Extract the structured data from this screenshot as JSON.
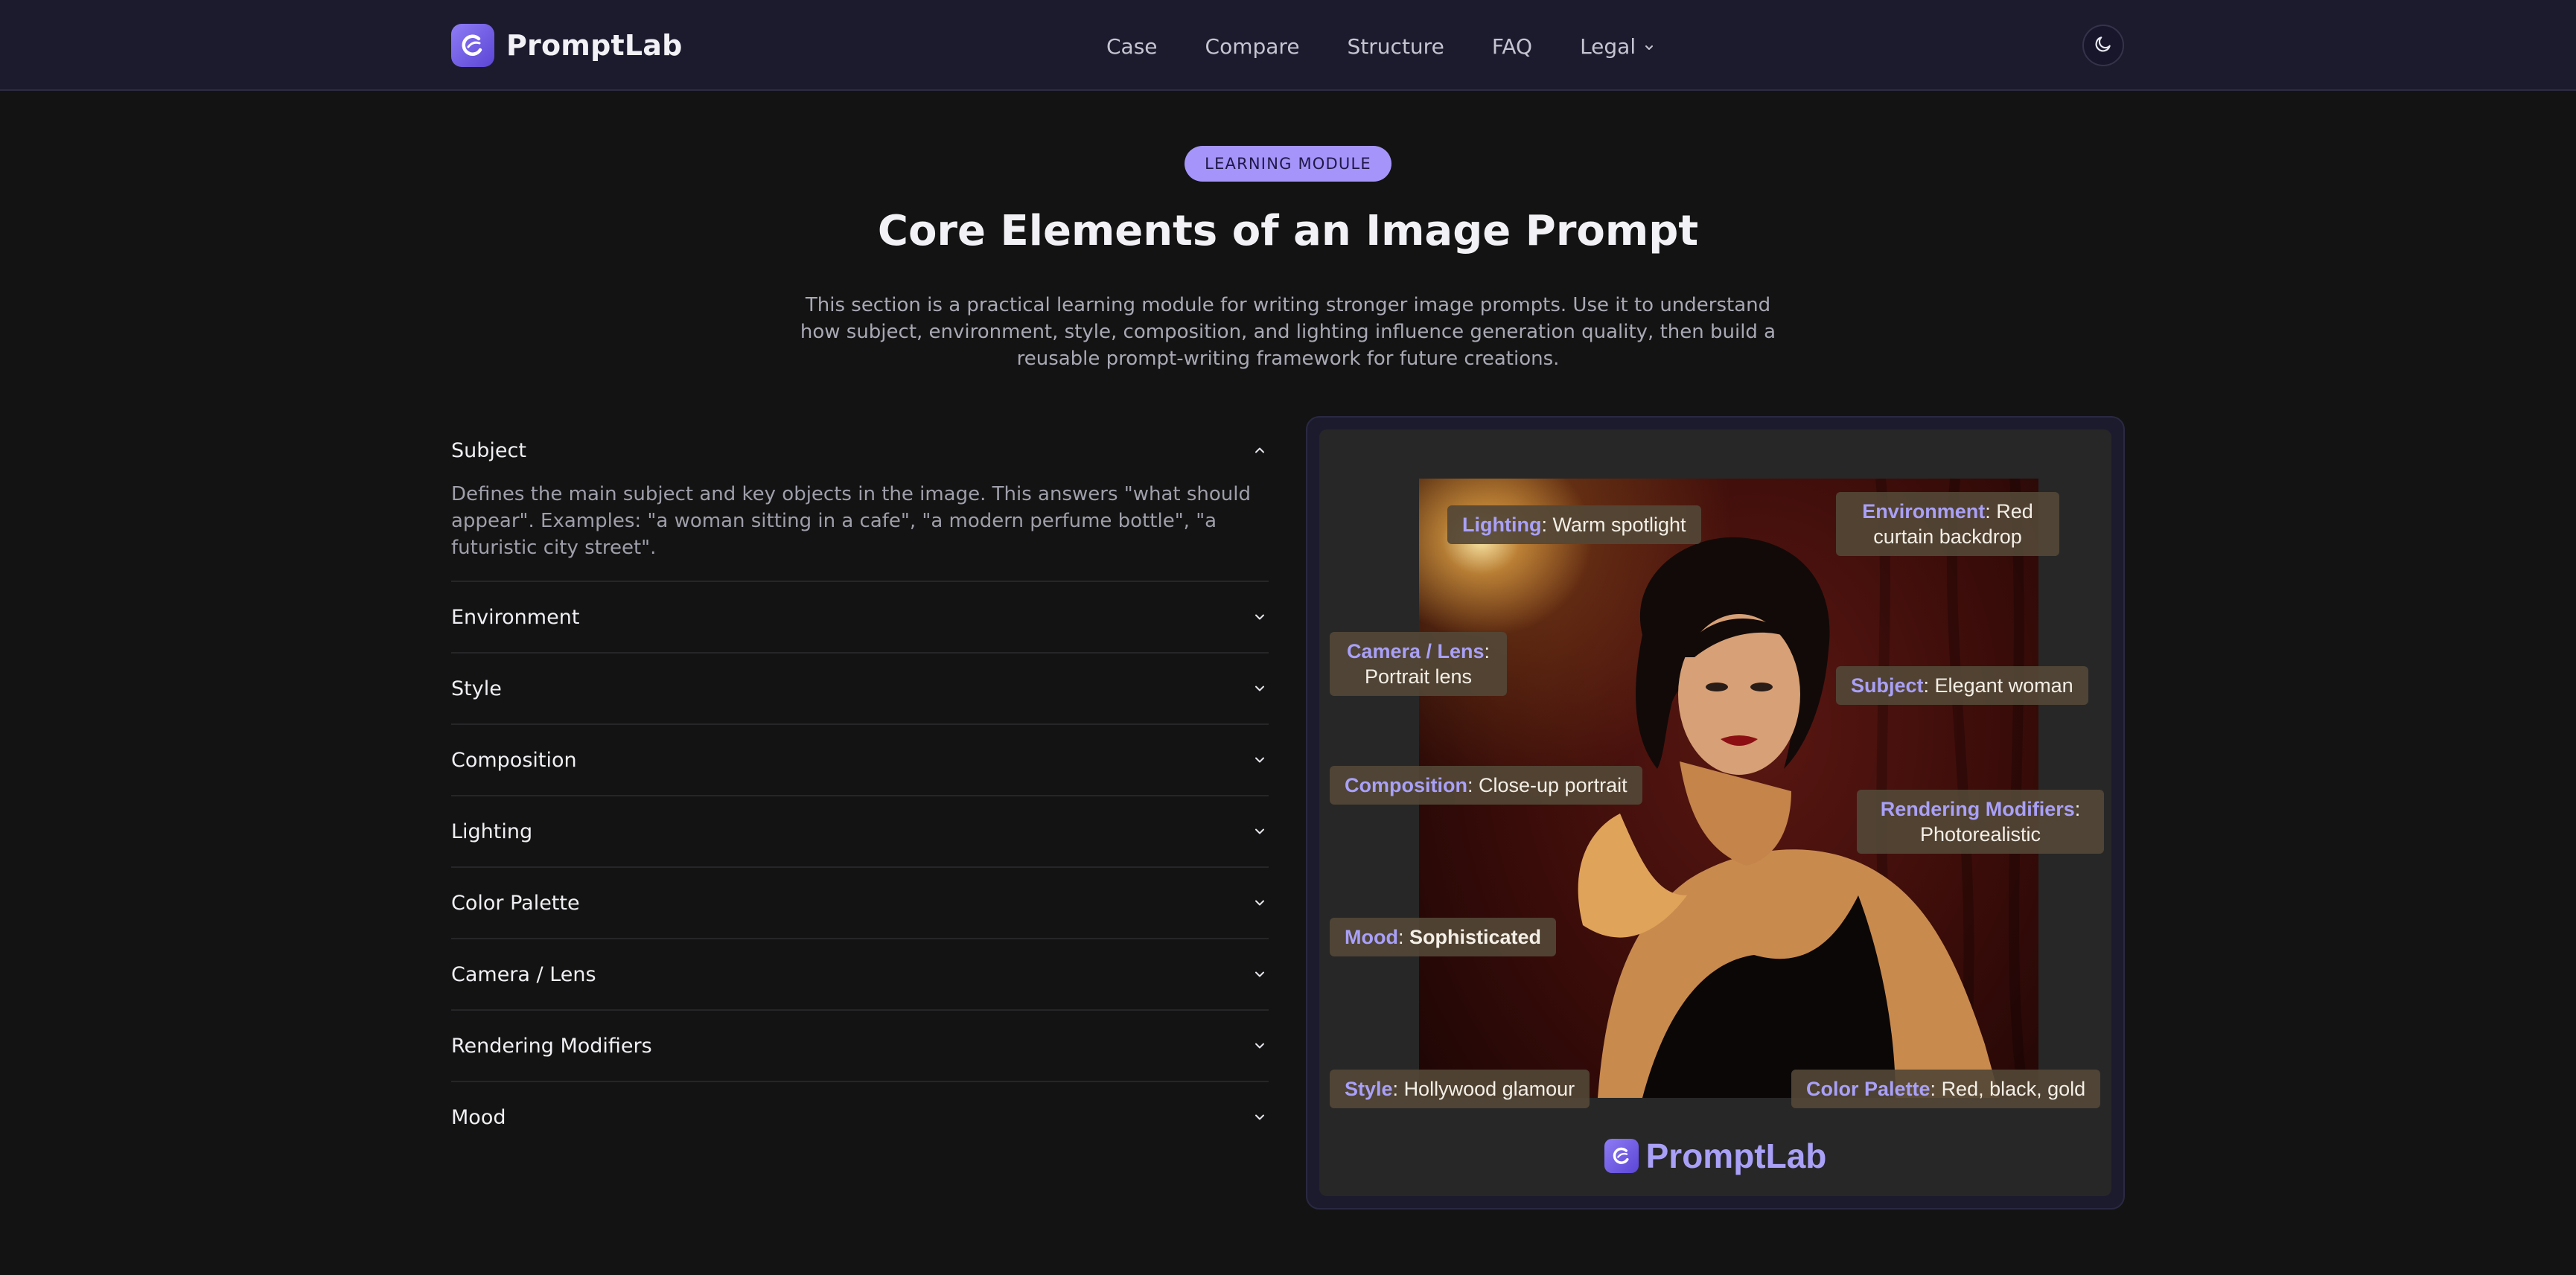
{
  "header": {
    "brand": "PromptLab",
    "nav": [
      {
        "label": "Case"
      },
      {
        "label": "Compare"
      },
      {
        "label": "Structure"
      },
      {
        "label": "FAQ"
      },
      {
        "label": "Legal",
        "has_dropdown": true
      }
    ],
    "theme_toggle_icon": "moon-icon"
  },
  "hero": {
    "badge": "LEARNING MODULE",
    "title": "Core Elements of an Image Prompt",
    "description": "This section is a practical learning module for writing stronger image prompts. Use it to understand how subject, environment, style, composition, and lighting influence generation quality, then build a reusable prompt-writing framework for future creations."
  },
  "accordion": [
    {
      "title": "Subject",
      "expanded": true,
      "body": "Defines the main subject and key objects in the image. This answers \"what should appear\". Examples: \"a woman sitting in a cafe\", \"a modern perfume bottle\", \"a futuristic city street\"."
    },
    {
      "title": "Environment",
      "expanded": false
    },
    {
      "title": "Style",
      "expanded": false
    },
    {
      "title": "Composition",
      "expanded": false
    },
    {
      "title": "Lighting",
      "expanded": false
    },
    {
      "title": "Color Palette",
      "expanded": false
    },
    {
      "title": "Camera / Lens",
      "expanded": false
    },
    {
      "title": "Rendering Modifiers",
      "expanded": false
    },
    {
      "title": "Mood",
      "expanded": false
    }
  ],
  "preview": {
    "tags": {
      "lighting": {
        "key": "Lighting",
        "value": "Warm spotlight"
      },
      "environment": {
        "key": "Environment",
        "value_line1": "Red",
        "value_line2": "curtain backdrop"
      },
      "camera": {
        "key": "Camera / Lens",
        "value": "Portrait lens"
      },
      "subject": {
        "key": "Subject",
        "value": "Elegant woman"
      },
      "composition": {
        "key": "Composition",
        "value": "Close-up portrait"
      },
      "rendering": {
        "key": "Rendering Modifiers",
        "value": "Photorealistic"
      },
      "mood": {
        "key": "Mood",
        "value": "Sophisticated"
      },
      "style": {
        "key": "Style",
        "value": "Hollywood glamour"
      },
      "palette": {
        "key": "Color Palette",
        "value": "Red, black, gold"
      }
    },
    "watermark": "PromptLab"
  },
  "colors": {
    "accent": "#a594f9",
    "background": "#131313",
    "navbar": "#1c1b2e"
  }
}
